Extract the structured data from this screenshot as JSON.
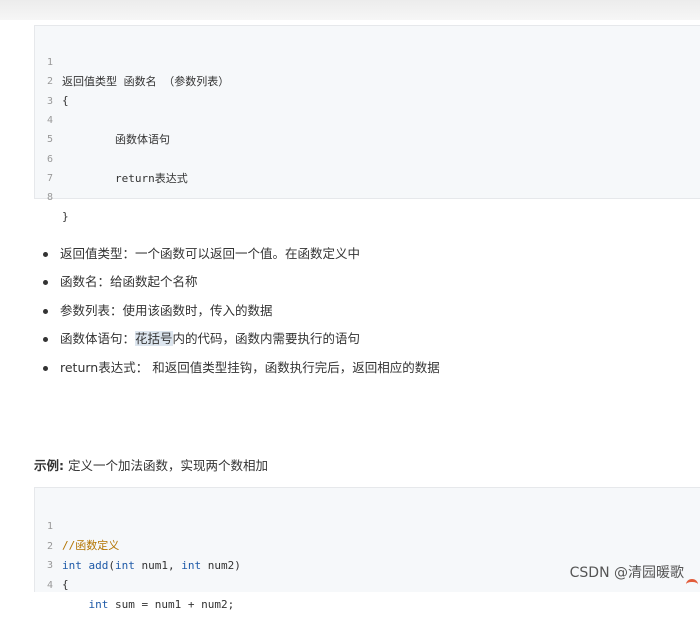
{
  "syntax_block": {
    "lines": [
      {
        "num": "1",
        "text": "返回值类型 函数名 （参数列表）"
      },
      {
        "num": "2",
        "text": "{"
      },
      {
        "num": "3",
        "text": ""
      },
      {
        "num": "4",
        "text": "        函数体语句"
      },
      {
        "num": "5",
        "text": ""
      },
      {
        "num": "6",
        "text": "        return表达式"
      },
      {
        "num": "7",
        "text": ""
      },
      {
        "num": "8",
        "text": "}"
      }
    ]
  },
  "bullets": [
    {
      "label": "返回值类型：",
      "text": "一个函数可以返回一个值。在函数定义中"
    },
    {
      "label": "函数名：",
      "text": "给函数起个名称"
    },
    {
      "label": "参数列表：",
      "text": "使用该函数时，传入的数据"
    },
    {
      "label": "函数体语句：",
      "highlight": "花括号",
      "text": "内的代码，函数内需要执行的语句"
    },
    {
      "label": "return表达式：",
      "text": " 和返回值类型挂钩，函数执行完后，返回相应的数据"
    }
  ],
  "example": {
    "label": "示例:",
    "text": "定义一个加法函数，实现两个数相加"
  },
  "example_code": {
    "lines": [
      {
        "num": "1",
        "comment": "//函数定义"
      },
      {
        "num": "2",
        "kw1": "int",
        "fn": " add",
        "p1": "(",
        "kw2": "int",
        "p2": " num1, ",
        "kw3": "int",
        "p3": " num2)"
      },
      {
        "num": "3",
        "text": "{"
      },
      {
        "num": "4",
        "indent": "    ",
        "kw": "int",
        "text": " sum = num1 + num2;"
      }
    ]
  },
  "watermark": "CSDN @清园暖歌",
  "colors": {
    "keyword": "#1e5aa8",
    "comment": "#b37400",
    "code_bg": "#f6f8fa"
  }
}
